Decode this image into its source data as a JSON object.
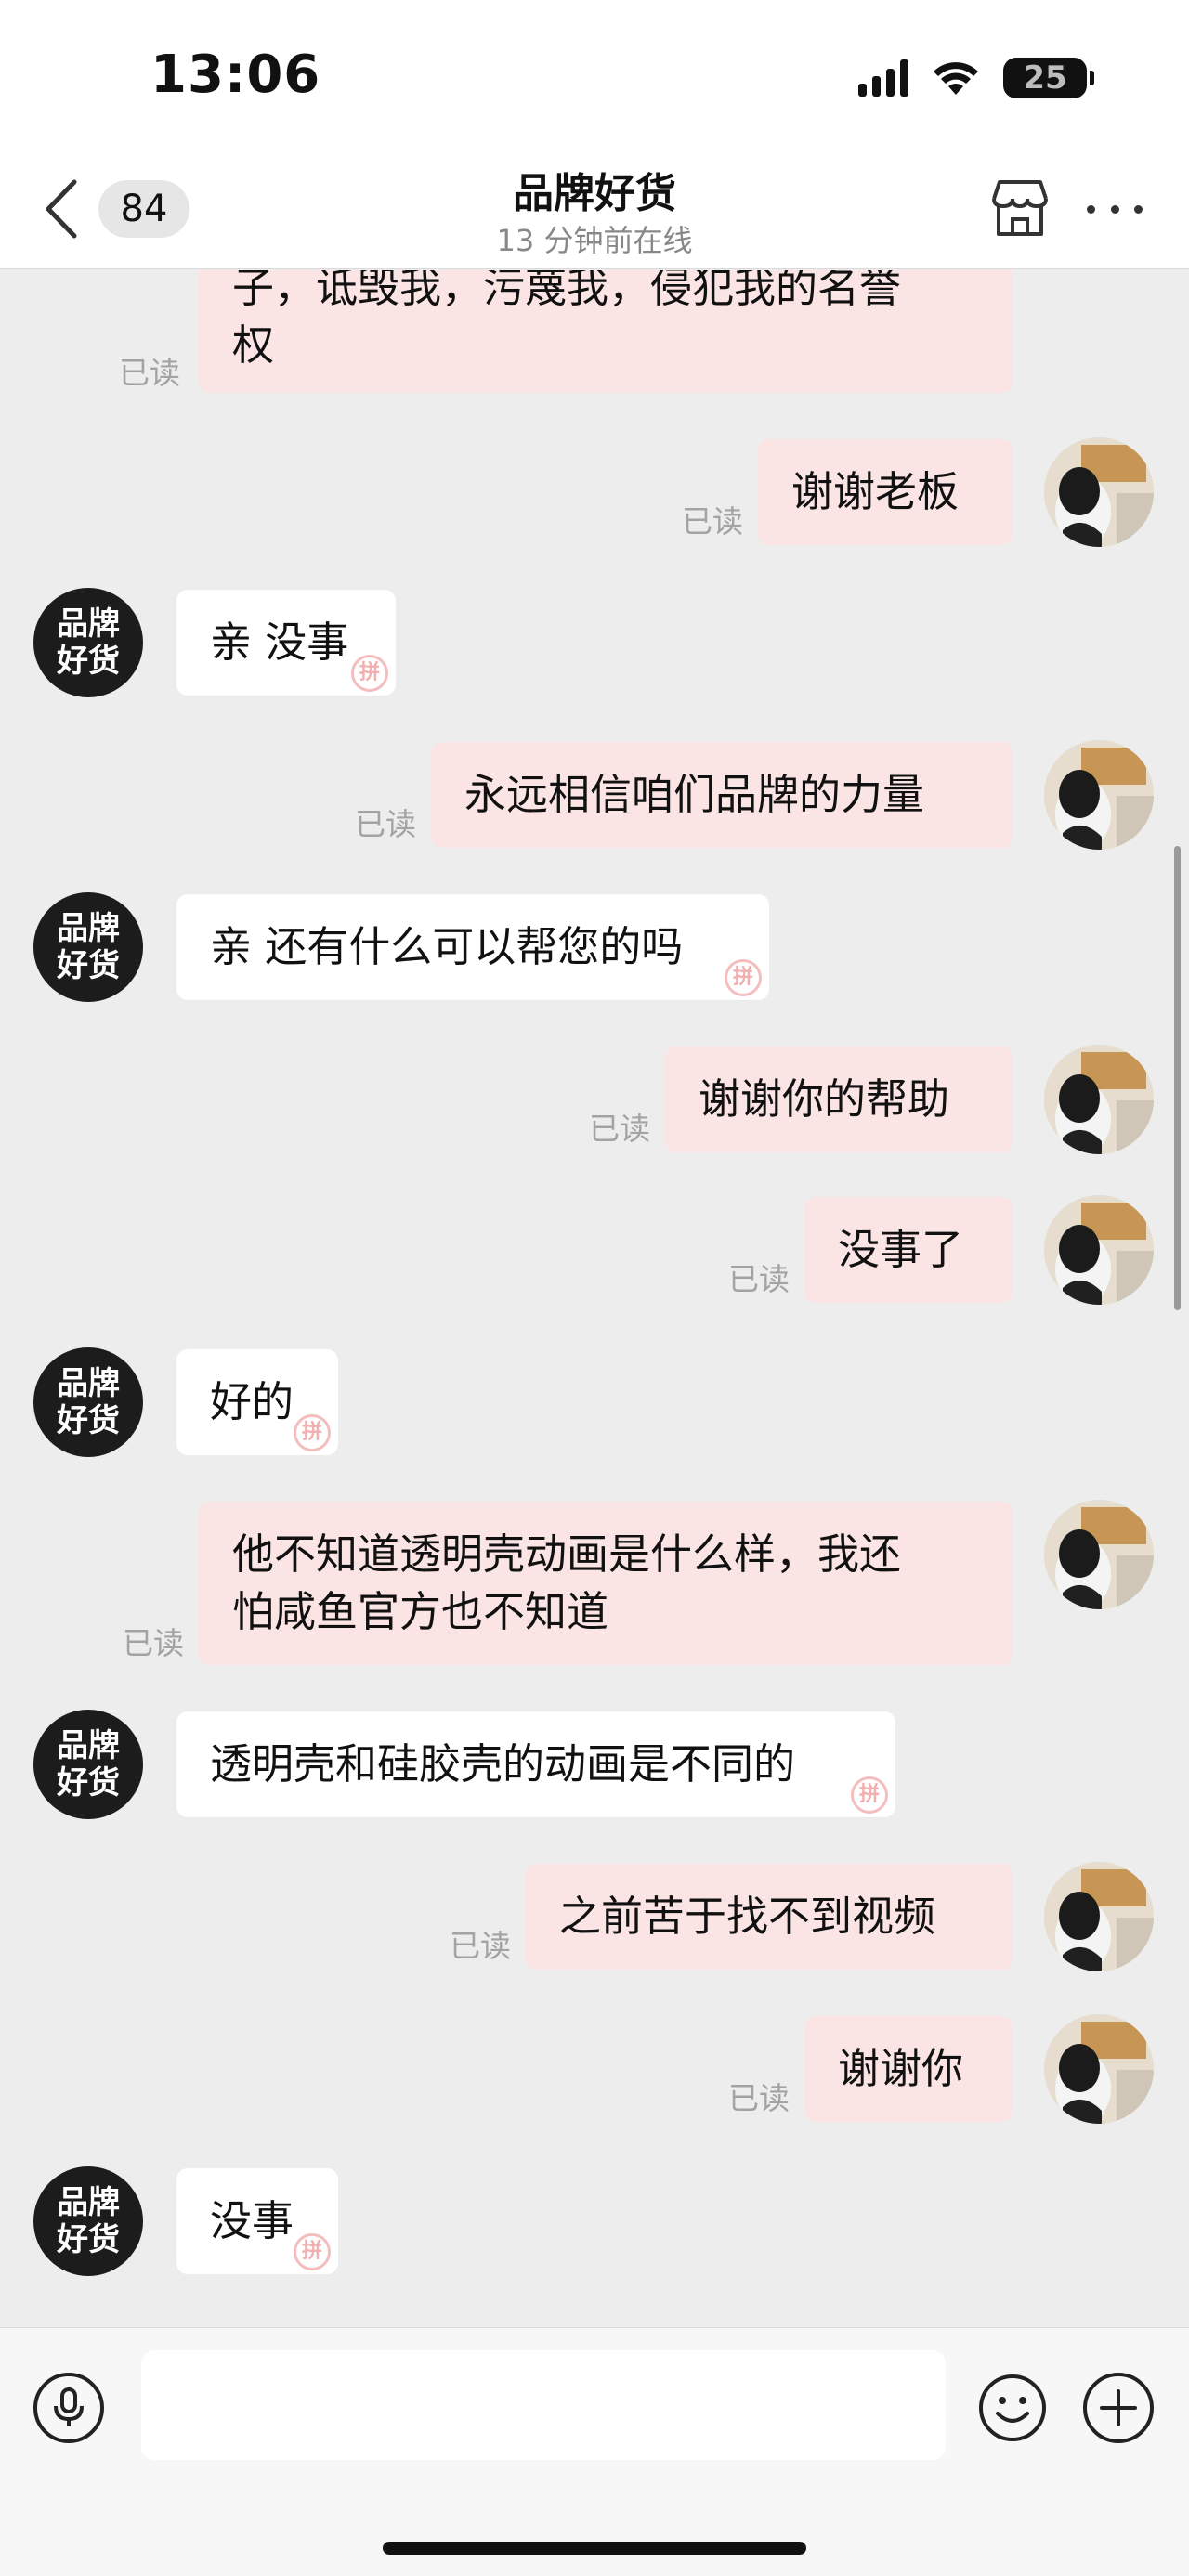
{
  "status_bar": {
    "time": "13:06",
    "battery": "25"
  },
  "nav": {
    "unread_count": "84",
    "title": "品牌好货",
    "subtitle": "13 分钟前在线"
  },
  "avatar_shop_text": [
    "品牌",
    "好货"
  ],
  "read_label": "已读",
  "messages": [
    {
      "dir": "out",
      "text": "子，诋毁我，污蔑我，侵犯我的名誉\n权",
      "read": "已读"
    },
    {
      "dir": "out",
      "text": "谢谢老板",
      "read": "已读"
    },
    {
      "dir": "in",
      "text": "亲 没事"
    },
    {
      "dir": "out",
      "text": "永远相信咱们品牌的力量",
      "read": "已读"
    },
    {
      "dir": "in",
      "text": "亲 还有什么可以帮您的吗"
    },
    {
      "dir": "out",
      "text": "谢谢你的帮助",
      "read": "已读"
    },
    {
      "dir": "out",
      "text": "没事了",
      "read": "已读"
    },
    {
      "dir": "in",
      "text": "好的"
    },
    {
      "dir": "out",
      "text": "他不知道透明壳动画是什么样，我还\n怕咸鱼官方也不知道",
      "read": "已读"
    },
    {
      "dir": "in",
      "text": "透明壳和硅胶壳的动画是不同的"
    },
    {
      "dir": "out",
      "text": "之前苦于找不到视频",
      "read": "已读"
    },
    {
      "dir": "out",
      "text": "谢谢你",
      "read": "已读"
    },
    {
      "dir": "in",
      "text": "没事"
    }
  ],
  "input": {
    "placeholder": ""
  },
  "colors": {
    "outgoing_bubble": "#fbe4e4",
    "incoming_bubble": "#ffffff",
    "background": "#ededed"
  }
}
